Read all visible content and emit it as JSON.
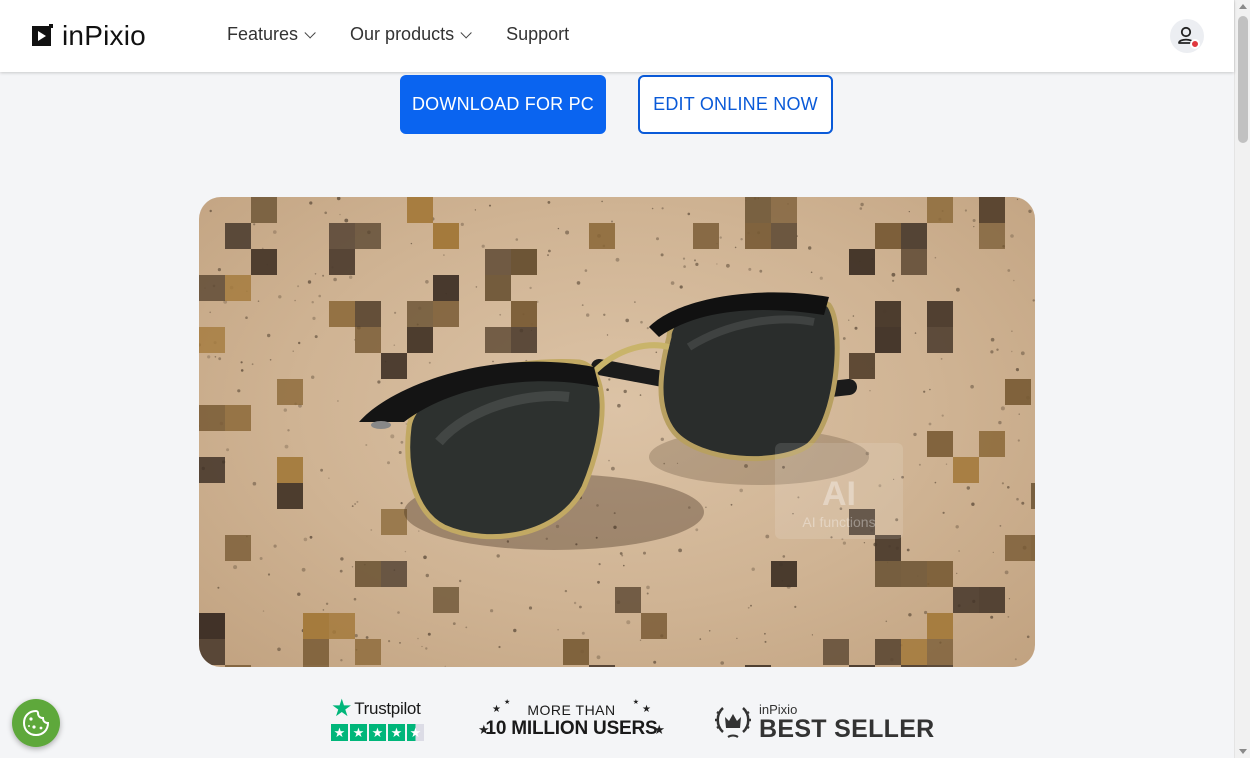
{
  "brand": {
    "name": "inPixio"
  },
  "nav": {
    "items": [
      {
        "label": "Features",
        "dropdown": true
      },
      {
        "label": "Our products",
        "dropdown": true
      },
      {
        "label": "Support",
        "dropdown": false
      }
    ]
  },
  "cta": {
    "primary_label": "DOWNLOAD FOR PC",
    "secondary_label": "EDIT ONLINE NOW"
  },
  "hero": {
    "overlay_title": "AI",
    "overlay_subtitle": "AI functions"
  },
  "badges": {
    "trustpilot": {
      "name": "Trustpilot",
      "rating_stars": 4.5
    },
    "users": {
      "line1": "MORE THAN",
      "line2": "10 MILLION USERS"
    },
    "bestseller": {
      "brand": "inPixio",
      "label": "BEST SELLER"
    }
  },
  "colors": {
    "primary": "#0a64f0",
    "trustpilot_green": "#00b67a",
    "cookie_green": "#5ea83b",
    "notification": "#e0383e"
  },
  "icons": {
    "logo": "play-square-icon",
    "account": "user-icon",
    "cookie": "cookie-icon"
  }
}
